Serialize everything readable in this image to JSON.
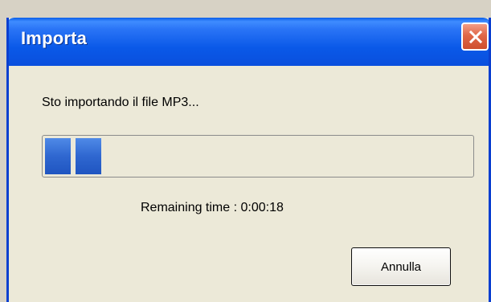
{
  "window": {
    "title": "Importa",
    "accent_color": "#0A59E8",
    "close_icon": "close-icon"
  },
  "dialog": {
    "message": "Sto importando il file MP3...",
    "progress": {
      "fraction": 0.13,
      "color": "#2F67D0"
    },
    "remaining_time": "Remaining time : 0:00:18",
    "cancel_label": "Annulla"
  }
}
